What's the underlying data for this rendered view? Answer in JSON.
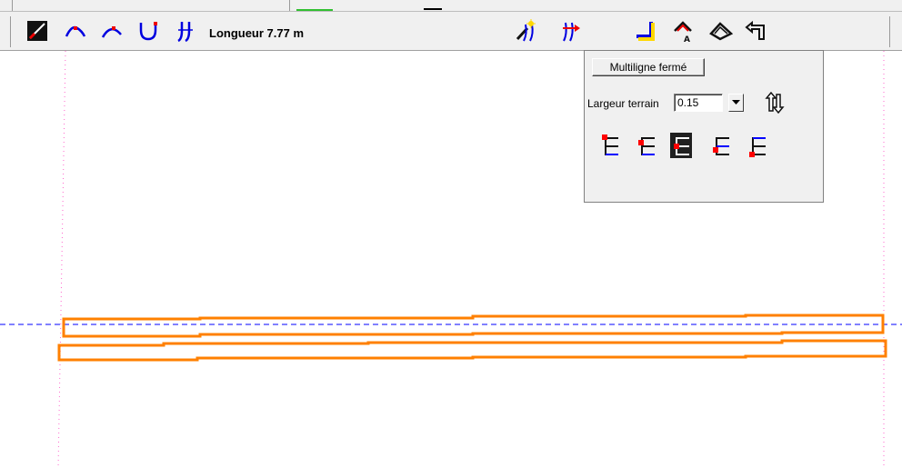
{
  "toolbar": {
    "length_label": "Longueur 7.77 m",
    "tools": [
      {
        "name": "pencil-icon"
      },
      {
        "name": "arc-three-points-icon"
      },
      {
        "name": "arc-tangent-icon"
      },
      {
        "name": "u-curve-icon"
      },
      {
        "name": "double-wall-curve-icon"
      },
      {
        "name": "magic-wall-icon"
      },
      {
        "name": "wall-arrow-icon"
      },
      {
        "name": "corner-icon"
      },
      {
        "name": "roof-a-icon"
      },
      {
        "name": "roof-outline-icon"
      },
      {
        "name": "undo-arrow-icon"
      }
    ]
  },
  "panel": {
    "closed_multiline_label": "Multiligne fermé",
    "width_label": "Largeur terrain",
    "width_value": "0.15",
    "alignment_options": [
      {
        "name": "align-left-top-icon",
        "selected": false
      },
      {
        "name": "align-left-mid-icon",
        "selected": false
      },
      {
        "name": "align-center-icon",
        "selected": true
      },
      {
        "name": "align-right-mid-icon",
        "selected": false
      },
      {
        "name": "align-right-bottom-icon",
        "selected": false
      }
    ]
  },
  "colors": {
    "wall_outline": "#ff8000",
    "guide_line": "#0000ff",
    "dotted_guide": "#ff66cc",
    "marker": "#ff0000"
  }
}
